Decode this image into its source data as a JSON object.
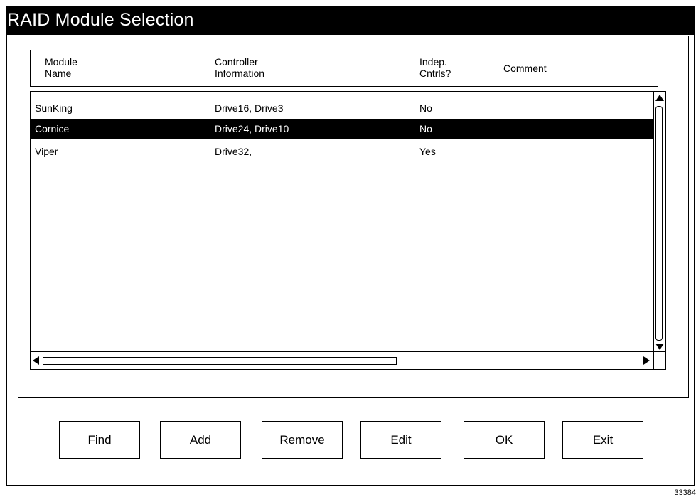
{
  "window": {
    "title": "RAID Module Selection"
  },
  "table": {
    "columns": [
      {
        "line1": "Module",
        "line2": "Name"
      },
      {
        "line1": "Controller",
        "line2": "Information"
      },
      {
        "line1": "Indep.",
        "line2": "Cntrls?"
      },
      {
        "label": "Comment"
      }
    ],
    "rows": [
      {
        "module_name": "SunKing",
        "controller_info": "Drive16, Drive3",
        "indep_cntrls": "No",
        "comment": "",
        "selected": false
      },
      {
        "module_name": "Cornice",
        "controller_info": "Drive24, Drive10",
        "indep_cntrls": "No",
        "comment": "",
        "selected": true
      },
      {
        "module_name": "Viper",
        "controller_info": "Drive32,",
        "indep_cntrls": "Yes",
        "comment": "",
        "selected": false
      }
    ]
  },
  "buttons": {
    "find": "Find",
    "add": "Add",
    "remove": "Remove",
    "edit": "Edit",
    "ok": "OK",
    "exit": "Exit"
  },
  "figure_id": "33384",
  "colors": {
    "selected_row_bg": "#000000",
    "selected_row_fg": "#ffffff",
    "titlebar_bg": "#000000"
  }
}
